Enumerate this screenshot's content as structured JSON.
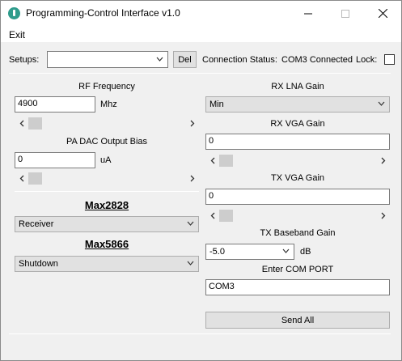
{
  "window": {
    "title": "Programming-Control Interface v1.0",
    "minimize": "—",
    "maximize": "☐",
    "close": "✕"
  },
  "menu": {
    "exit": "Exit"
  },
  "toolbar": {
    "setups_label": "Setups:",
    "setups_value": "",
    "del_label": "Del",
    "connection_label": "Connection Status:",
    "connection_value": "COM3 Connected",
    "lock_label": "Lock:",
    "lock_checked": false
  },
  "left": {
    "rf_frequency_label": "RF Frequency",
    "rf_frequency_value": "4900",
    "rf_frequency_unit": "Mhz",
    "pa_dac_label": "PA DAC Output Bias",
    "pa_dac_value": "0",
    "pa_dac_unit": "uA",
    "max2828_heading": "Max2828",
    "max2828_mode": "Receiver",
    "max5866_heading": "Max5866",
    "max5866_mode": "Shutdown"
  },
  "right": {
    "rx_lna_label": "RX LNA Gain",
    "rx_lna_value": "Min",
    "rx_vga_label": "RX VGA Gain",
    "rx_vga_value": "0",
    "tx_vga_label": "TX VGA Gain",
    "tx_vga_value": "0",
    "tx_baseband_label": "TX Baseband Gain",
    "tx_baseband_value": "-5.0",
    "tx_baseband_unit": "dB",
    "com_port_label": "Enter COM PORT",
    "com_port_value": "COM3",
    "send_all_label": "Send All"
  },
  "icons": {
    "scroll_left": "‹",
    "scroll_right": "›"
  }
}
